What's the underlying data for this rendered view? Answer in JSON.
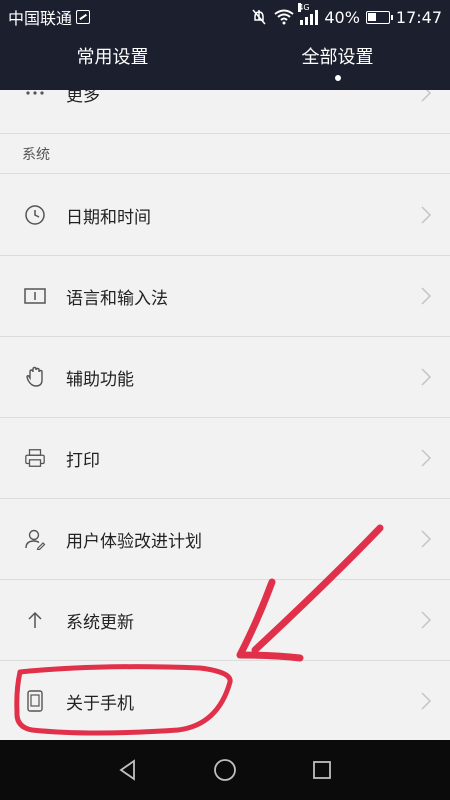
{
  "status_bar": {
    "carrier": "中国联通",
    "network_type": "4G",
    "battery": "40%",
    "time": "17:47"
  },
  "tabs": [
    {
      "label": "常用设置",
      "active": false
    },
    {
      "label": "全部设置",
      "active": true
    }
  ],
  "list": {
    "partial_item": "更多",
    "section_title": "系统",
    "items": [
      {
        "label": "日期和时间",
        "icon": "clock-icon"
      },
      {
        "label": "语言和输入法",
        "icon": "keyboard-icon"
      },
      {
        "label": "辅助功能",
        "icon": "hand-icon"
      },
      {
        "label": "打印",
        "icon": "printer-icon"
      },
      {
        "label": "用户体验改进计划",
        "icon": "user-experience-icon"
      },
      {
        "label": "系统更新",
        "icon": "arrow-up-icon"
      },
      {
        "label": "关于手机",
        "icon": "phone-icon"
      }
    ]
  },
  "navbar": {
    "buttons": [
      "back-icon",
      "home-icon",
      "recents-icon"
    ]
  },
  "colors": {
    "header_bg": "#1b1f2e",
    "list_bg": "#f2f2f2",
    "annotation": "#e0304a"
  }
}
